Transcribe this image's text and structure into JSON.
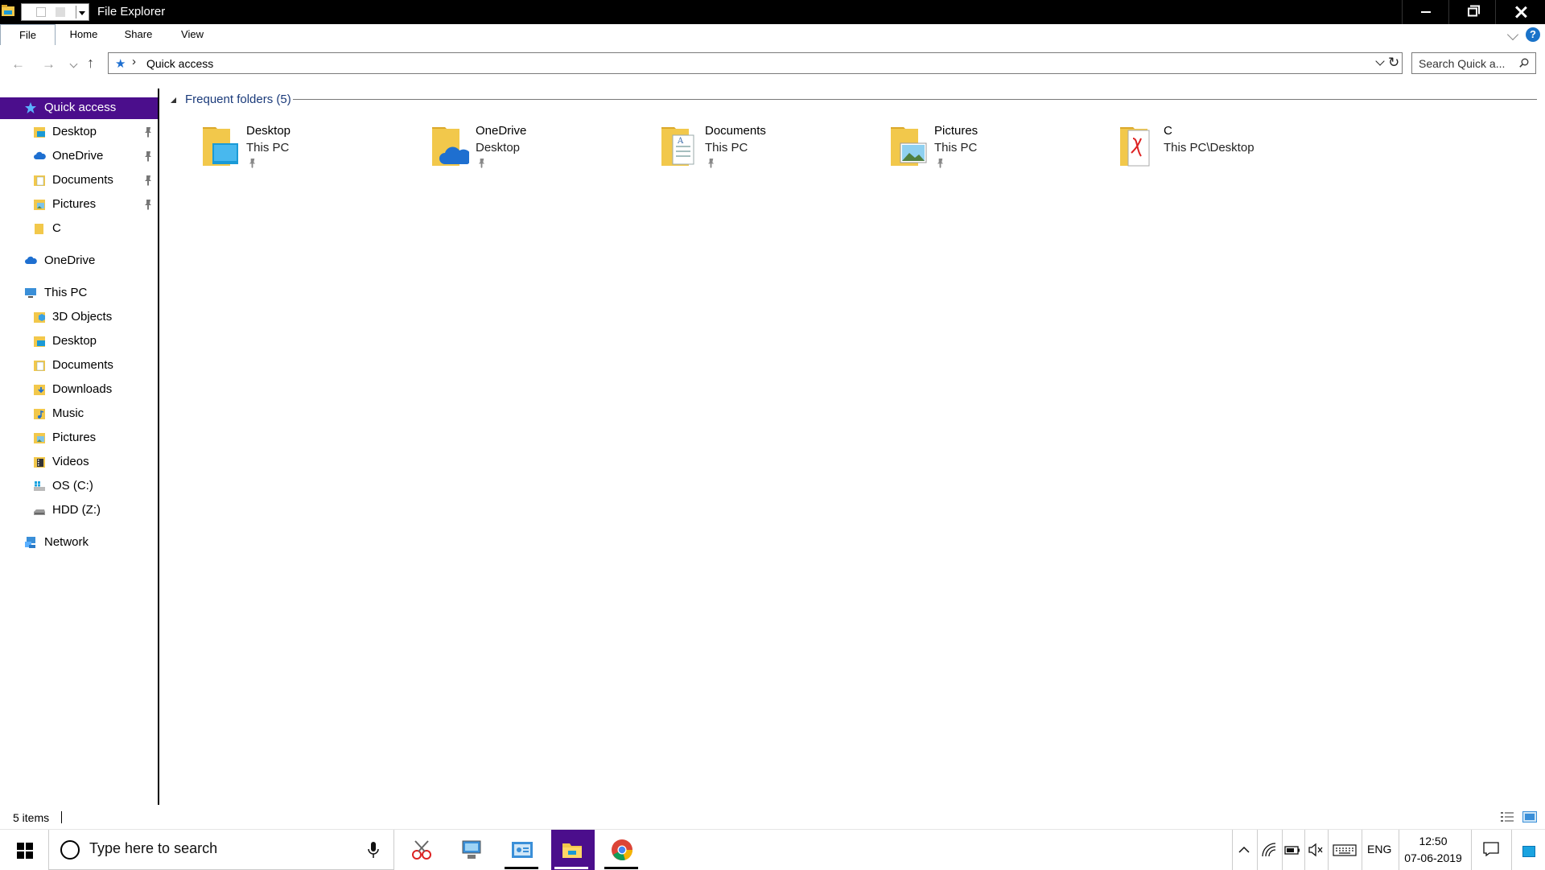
{
  "window": {
    "title": "File Explorer"
  },
  "ribbon": {
    "tabs": [
      {
        "label": "File"
      },
      {
        "label": "Home"
      },
      {
        "label": "Share"
      },
      {
        "label": "View"
      }
    ],
    "help_label": "?"
  },
  "navigation": {
    "back_glyph": "←",
    "forward_glyph": "→",
    "up_glyph": "↑",
    "address": {
      "path": "Quick access"
    },
    "search": {
      "placeholder": "Search Quick a..."
    }
  },
  "sidebar": {
    "quick_access": {
      "label": "Quick access",
      "icon": "star-icon"
    },
    "quick_items": [
      {
        "label": "Desktop",
        "icon": "desktop-folder-icon",
        "pinned": true
      },
      {
        "label": "OneDrive",
        "icon": "onedrive-icon",
        "pinned": true
      },
      {
        "label": "Documents",
        "icon": "documents-folder-icon",
        "pinned": true
      },
      {
        "label": "Pictures",
        "icon": "pictures-folder-icon",
        "pinned": true
      },
      {
        "label": "C",
        "icon": "folder-icon",
        "pinned": false
      }
    ],
    "onedrive": {
      "label": "OneDrive",
      "icon": "onedrive-icon"
    },
    "this_pc": {
      "label": "This PC",
      "icon": "computer-icon"
    },
    "pc_items": [
      {
        "label": "3D Objects",
        "icon": "3d-objects-folder-icon"
      },
      {
        "label": "Desktop",
        "icon": "desktop-folder-icon"
      },
      {
        "label": "Documents",
        "icon": "documents-folder-icon"
      },
      {
        "label": "Downloads",
        "icon": "downloads-folder-icon"
      },
      {
        "label": "Music",
        "icon": "music-folder-icon"
      },
      {
        "label": "Pictures",
        "icon": "pictures-folder-icon"
      },
      {
        "label": "Videos",
        "icon": "videos-folder-icon"
      },
      {
        "label": "OS (C:)",
        "icon": "os-drive-icon"
      },
      {
        "label": "HDD (Z:)",
        "icon": "hard-drive-icon"
      }
    ],
    "network": {
      "label": "Network",
      "icon": "network-icon"
    }
  },
  "content": {
    "group_title": "Frequent folders (5)",
    "folders": [
      {
        "name": "Desktop",
        "location": "This PC",
        "icon": "desktop-folder-icon"
      },
      {
        "name": "OneDrive",
        "location": "Desktop",
        "icon": "onedrive-folder-icon"
      },
      {
        "name": "Documents",
        "location": "This PC",
        "icon": "documents-folder-icon"
      },
      {
        "name": "Pictures",
        "location": "This PC",
        "icon": "pictures-folder-icon"
      },
      {
        "name": "C",
        "location": "This PC\\Desktop",
        "icon": "pdf-folder-icon"
      }
    ]
  },
  "status": {
    "item_count": "5 items"
  },
  "taskbar": {
    "search_placeholder": "Type here to search",
    "apps": [
      {
        "name": "snipping-tool",
        "active": false
      },
      {
        "name": "remote-desktop",
        "active": false
      },
      {
        "name": "control-panel",
        "active": false
      },
      {
        "name": "file-explorer",
        "active": true
      },
      {
        "name": "chrome",
        "active": false
      }
    ],
    "language": "ENG",
    "time": "12:50",
    "date": "07-06-2019"
  },
  "colors": {
    "accent": "#4b0e8c",
    "folder_yellow": "#f2c84b",
    "folder_yellow_dark": "#dba82a",
    "link_blue": "#1a3a7a",
    "star_blue": "#1e6fd0"
  }
}
